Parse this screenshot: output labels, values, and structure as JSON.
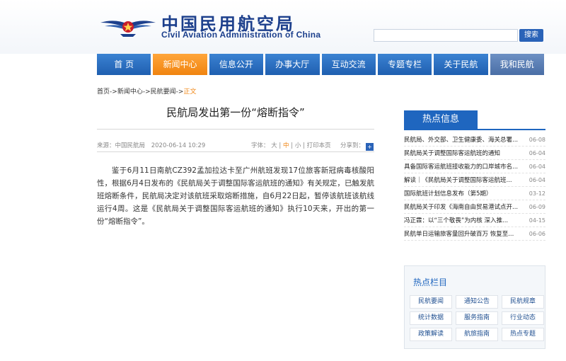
{
  "header": {
    "logo_cn": "中国民用航空局",
    "logo_en": "Civil Aviation Administration of China",
    "search_button": "搜索",
    "search_placeholder": ""
  },
  "nav": {
    "items": [
      {
        "label": "首 页"
      },
      {
        "label": "新闻中心",
        "active": true
      },
      {
        "label": "信息公开"
      },
      {
        "label": "办事大厅"
      },
      {
        "label": "互动交流"
      },
      {
        "label": "专题专栏"
      },
      {
        "label": "关于民航"
      },
      {
        "label": "我和民航"
      }
    ]
  },
  "breadcrumb": {
    "parts": [
      "首页",
      "新闻中心",
      "民航要闻"
    ],
    "sep": "->",
    "current": "正文"
  },
  "article": {
    "title": "民航局发出第一份“熔断指令”",
    "source": "来源：中国民航局",
    "date": "2020-06-14 10:29",
    "font_label": "字体：",
    "font_large": "大",
    "font_medium": "中",
    "font_small": "小",
    "print_label": "打印本页",
    "share_label": "分享到：",
    "body": "鉴于6月11日南航CZ392孟加拉达卡至广州航班发现17位旅客新冠病毒核酸阳性，根据6月4日发布的《民航局关于调整国际客运航班的通知》有关规定，已触发航班熔断条件，民航局决定对该航班采取熔断措施，自6月22日起，暂停该航班该航线运行4周。这是《民航局关于调整国际客运航班的通知》执行10天来，开出的第一份“熔断指令”。"
  },
  "sidebar": {
    "hot_title": "热点信息",
    "hot_items": [
      {
        "title": "民航局、外交部、卫生健康委、海关总署...",
        "date": "06-08"
      },
      {
        "title": "民航局关于调整国际客运航班的通知",
        "date": "06-04"
      },
      {
        "title": "具备国际客运航班接收能力的口岸城市名...",
        "date": "06-04"
      },
      {
        "title": "解读｜《民航局关于调整国际客运航班...",
        "date": "06-04"
      },
      {
        "title": "国际航班计划信息发布（第5期）",
        "date": "03-12"
      },
      {
        "title": "民航局关于印发《海南自由贸易港试点开...",
        "date": "06-09"
      },
      {
        "title": "冯正霖：以“三个敬畏”为内核 深入推...",
        "date": "04-15"
      },
      {
        "title": "民航单日运输旅客量回升破百万 恢复至...",
        "date": "06-06"
      }
    ],
    "cols_title": "热点栏目",
    "cols": [
      "民航要闻",
      "通知公告",
      "民航规章",
      "统计数据",
      "服务指南",
      "行业动态",
      "政策解读",
      "航旅指南",
      "热点专题"
    ]
  },
  "colors": {
    "brand_blue": "#1f66bf",
    "nav_active": "#f08410",
    "logo_text": "#1c3f8c"
  }
}
